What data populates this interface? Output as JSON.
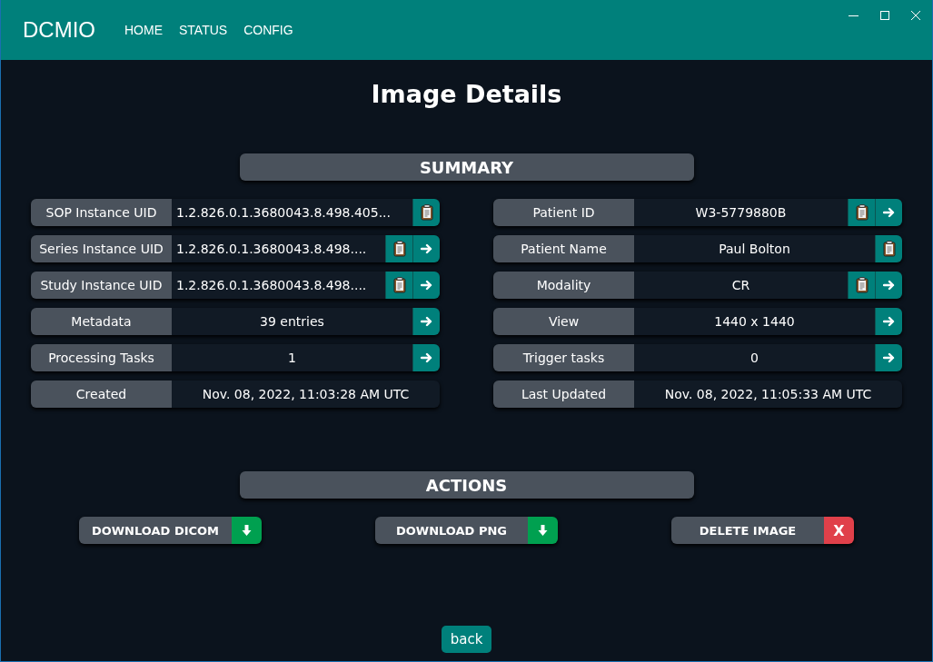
{
  "app": {
    "brand": "DCMIO",
    "nav": [
      {
        "label": "HOME"
      },
      {
        "label": "STATUS"
      },
      {
        "label": "CONFIG"
      }
    ]
  },
  "title": "Image Details",
  "summary": {
    "heading": "SUMMARY",
    "columns": [
      [
        {
          "label": "SOP Instance UID",
          "value": "1.2.826.0.1.3680043.8.498.405...",
          "kind": "uid",
          "copy": true,
          "link": false
        },
        {
          "label": "Series Instance UID",
          "value": "1.2.826.0.1.3680043.8.498....",
          "kind": "uid",
          "copy": true,
          "link": true
        },
        {
          "label": "Study Instance UID",
          "value": "1.2.826.0.1.3680043.8.498....",
          "kind": "uid",
          "copy": true,
          "link": true
        },
        {
          "label": "Metadata",
          "value": "39 entries",
          "kind": "plain",
          "copy": false,
          "link": true
        },
        {
          "label": "Processing Tasks",
          "value": "1",
          "kind": "plain",
          "copy": false,
          "link": true
        },
        {
          "label": "Created",
          "value": "Nov. 08, 2022, 11:03:28 AM UTC",
          "kind": "plain",
          "copy": false,
          "link": false
        }
      ],
      [
        {
          "label": "Patient ID",
          "value": "W3-5779880B",
          "kind": "plain",
          "copy": true,
          "link": true
        },
        {
          "label": "Patient Name",
          "value": "Paul Bolton",
          "kind": "plain",
          "copy": true,
          "link": false
        },
        {
          "label": "Modality",
          "value": "CR",
          "kind": "plain",
          "copy": true,
          "link": true
        },
        {
          "label": "View",
          "value": "1440 x 1440",
          "kind": "plain",
          "copy": false,
          "link": true
        },
        {
          "label": "Trigger tasks",
          "value": "0",
          "kind": "plain",
          "copy": false,
          "link": true
        },
        {
          "label": "Last Updated",
          "value": "Nov. 08, 2022, 11:05:33 AM UTC",
          "kind": "plain",
          "copy": false,
          "link": false
        }
      ]
    ]
  },
  "actions": {
    "heading": "ACTIONS",
    "buttons": [
      {
        "label": "DOWNLOAD DICOM",
        "kind": "download"
      },
      {
        "label": "DOWNLOAD PNG",
        "kind": "download"
      },
      {
        "label": "DELETE IMAGE",
        "kind": "delete",
        "icon_text": "X"
      }
    ]
  },
  "back": "back"
}
